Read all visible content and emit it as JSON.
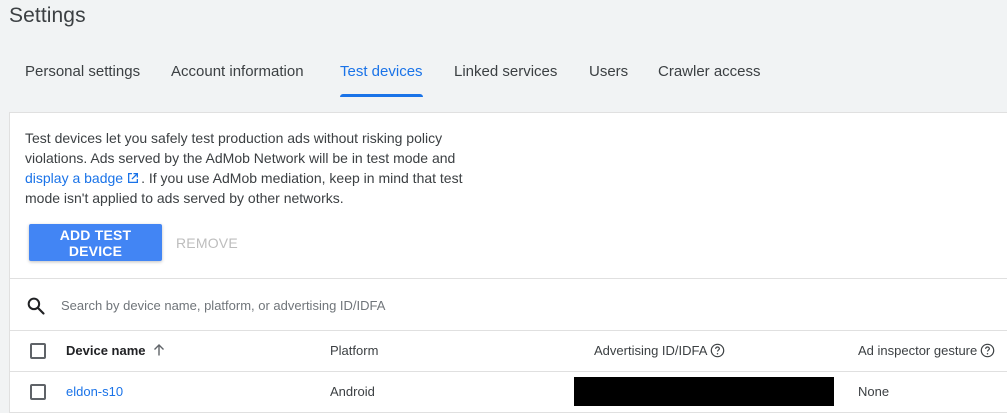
{
  "page": {
    "title": "Settings"
  },
  "tabs": [
    {
      "label": "Personal settings"
    },
    {
      "label": "Account information"
    },
    {
      "label": "Test devices",
      "active": true
    },
    {
      "label": "Linked services"
    },
    {
      "label": "Users"
    },
    {
      "label": "Crawler access"
    }
  ],
  "intro": {
    "text_before_link": "Test devices let you safely test production ads without risking policy violations. Ads served by the AdMob Network will be in test mode and ",
    "link_text": "display a badge",
    "text_after_link": ". If you use AdMob mediation, keep in mind that test mode isn't applied to ads served by other networks."
  },
  "actions": {
    "add_label": "ADD TEST DEVICE",
    "remove_label": "REMOVE"
  },
  "search": {
    "placeholder": "Search by device name, platform, or advertising ID/IDFA",
    "value": ""
  },
  "table": {
    "columns": {
      "device_name": "Device name",
      "platform": "Platform",
      "advertising_id": "Advertising ID/IDFA",
      "ad_inspector_gesture": "Ad inspector gesture"
    },
    "rows": [
      {
        "device_name": "eldon-s10",
        "platform": "Android",
        "advertising_id": "",
        "ad_inspector_gesture": "None"
      }
    ]
  },
  "colors": {
    "accent": "#1a73e8",
    "button_primary": "#4285f4",
    "disabled_text": "#bdbdbd",
    "background": "#f1f3f4"
  }
}
